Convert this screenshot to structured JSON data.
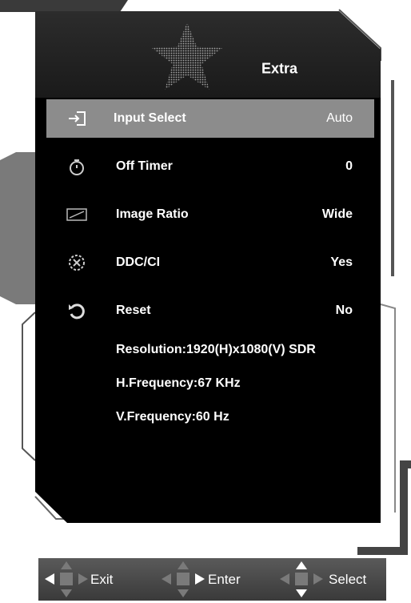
{
  "header": {
    "title": "Extra"
  },
  "menu": [
    {
      "label": "Input Select",
      "value": "Auto",
      "icon": "input-icon",
      "selected": true
    },
    {
      "label": "Off Timer",
      "value": "0",
      "icon": "timer-icon",
      "selected": false
    },
    {
      "label": "Image Ratio",
      "value": "Wide",
      "icon": "aspect-ratio-icon",
      "selected": false
    },
    {
      "label": "DDC/CI",
      "value": "Yes",
      "icon": "ddc-ci-icon",
      "selected": false
    },
    {
      "label": "Reset",
      "value": "No",
      "icon": "reset-icon",
      "selected": false
    }
  ],
  "info": {
    "resolution": "Resolution:1920(H)x1080(V) SDR",
    "h_frequency": "H.Frequency:67 KHz",
    "v_frequency": "V.Frequency:60 Hz"
  },
  "nav": {
    "exit": "Exit",
    "enter": "Enter",
    "select": "Select"
  },
  "colors": {
    "panel": "#000000",
    "selected_row": "#8c8c8c",
    "nav_bar": "#4a4a4a",
    "text": "#ffffff"
  }
}
